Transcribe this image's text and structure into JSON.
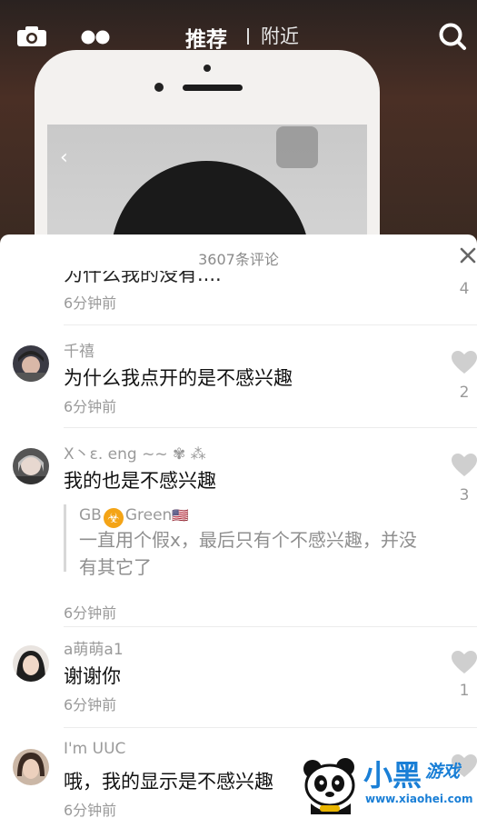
{
  "topbar": {
    "tab_recommend": "推荐",
    "tab_nearby": "附近",
    "icons": [
      "camera-icon",
      "dots-icon",
      "search-icon"
    ]
  },
  "sheet": {
    "title": "3607条评论",
    "close_icon": "close-icon"
  },
  "comments": [
    {
      "user": "",
      "text": "为什么我的没有....",
      "time": "6分钟前",
      "likes": "4"
    },
    {
      "user": "千禧",
      "text": "为什么我点开的是不感兴趣",
      "time": "6分钟前",
      "likes": "2"
    },
    {
      "user": "X丶ε. eng ~~ ✾ ⁂",
      "text": "我的也是不感兴趣",
      "time": "6分钟前",
      "likes": "3",
      "reply": {
        "user_prefix": "GB",
        "user_suffix": "Green",
        "emoji": "☣",
        "flag": "🇺🇸",
        "text": "一直用个假x，最后只有个不感兴趣，并没有其它了"
      }
    },
    {
      "user": "a萌萌a1",
      "text": "谢谢你",
      "time": "6分钟前",
      "likes": "1"
    },
    {
      "user": "I'm UUC",
      "text": "哦，我的显示是不感兴趣",
      "time": "6分钟前",
      "likes": ""
    }
  ],
  "watermark": {
    "brand": "小黑",
    "sub": "游戏",
    "url": "www.xiaohei.com"
  },
  "colors": {
    "sheet_bg": "#ffffff",
    "secondary_text": "#9a9a9a",
    "primary_text": "#111111",
    "watermark_blue": "#1a7fd6"
  }
}
